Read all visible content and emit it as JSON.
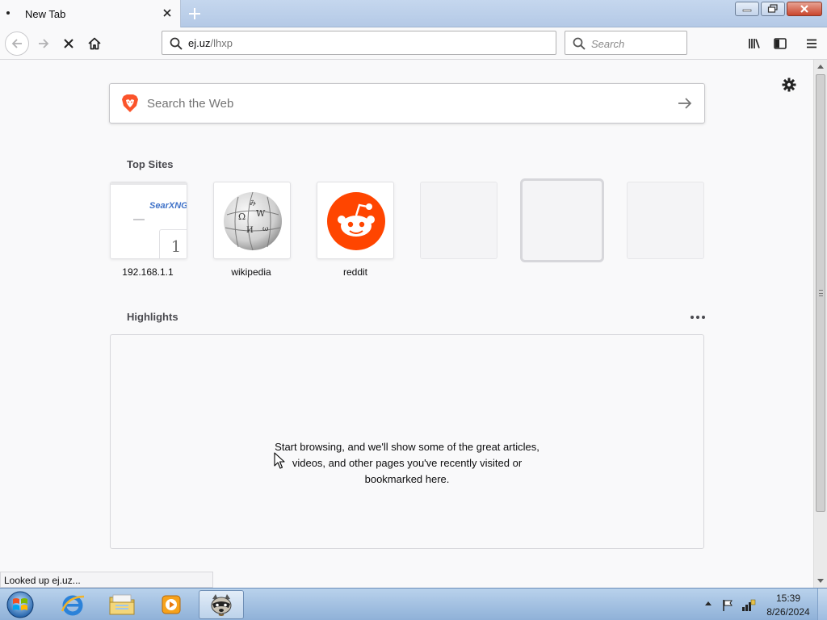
{
  "window": {
    "tab_title": "New Tab"
  },
  "navbar": {
    "url_host": "ej.uz",
    "url_path": "/lhxp",
    "search_placeholder": "Search"
  },
  "newtab": {
    "websearch_placeholder": "Search the Web",
    "top_sites_title": "Top Sites",
    "top_sites": [
      {
        "label": "192.168.1.1",
        "preview_brand": "SearXNG",
        "badge": "1"
      },
      {
        "label": "wikipedia"
      },
      {
        "label": "reddit"
      }
    ],
    "highlights_title": "Highlights",
    "highlights_message_lines": [
      "Start browsing, and we'll show some of the great articles,",
      "videos, and other pages you've recently visited or",
      "bookmarked here."
    ]
  },
  "status": {
    "text": "Looked up ej.uz..."
  },
  "taskbar": {
    "time": "15:39",
    "date": "8/26/2024"
  },
  "colors": {
    "reddit": "#ff4500",
    "brave": "#fb542b",
    "taskbar": "#9fbfe2"
  }
}
